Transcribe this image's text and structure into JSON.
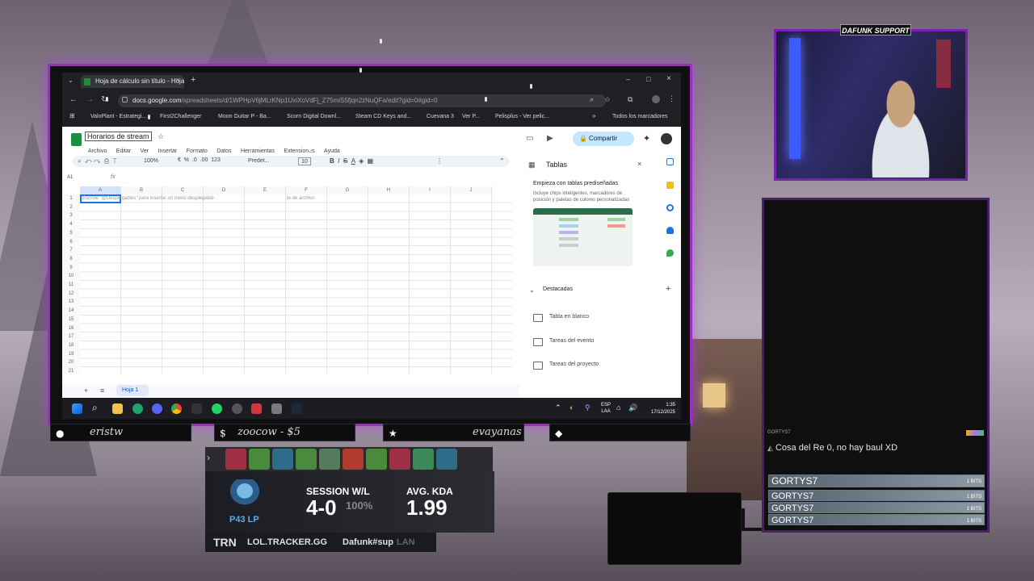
{
  "browser": {
    "tab_title": "Hoja de cálculo sin título - Hoja",
    "url_prefix": "docs.google.com",
    "url_rest": "/spreadsheets/d/1WPHpV6jMLrKNp1UxiXoVdFj_Z75miS5fjqn2zNuQFa/edit?gid=0#gid=0",
    "bookmarks": [
      "ValoPlant - Estrategi...",
      "First2Challenger",
      "Moon Guitar P - Ba...",
      "Scorn Digital Downl...",
      "Steam CD Keys and...",
      "Cuevana 3",
      "Ver P...",
      "Pelisplus - Ver pelic..."
    ],
    "all_bookmarks": "Todos los marcadores"
  },
  "sheets": {
    "doc_title": "Horarios de stream",
    "menu": [
      "Archivo",
      "Editar",
      "Ver",
      "Insertar",
      "Formato",
      "Datos",
      "Herramientas",
      "Extensiones",
      "Ayuda"
    ],
    "zoom": "100%",
    "font": "Predet...",
    "font_size": "10",
    "cell_ref": "A1",
    "share_label": "Compartir",
    "columns": [
      "A",
      "B",
      "C",
      "D",
      "E",
      "F",
      "G",
      "H",
      "I",
      "J"
    ],
    "rows": [
      "1",
      "2",
      "3",
      "4",
      "5",
      "6",
      "7",
      "8",
      "9",
      "10",
      "11",
      "12",
      "13",
      "14",
      "15",
      "16",
      "17",
      "18",
      "19",
      "20",
      "21"
    ],
    "hint_text": "Escribe \"@Desplegables\" para insertar un menú desplegable",
    "hint_text_2": "te de archivo",
    "sheet_tab": "Hoja 1"
  },
  "side_panel": {
    "title": "Tablas",
    "heading": "Empieza con tablas prediseñadas",
    "description": "Incluye chips inteligentes, marcadores de posición y paletas de colores personalizadas",
    "section": "Destacadas",
    "items": [
      "Tabla en blanco",
      "Tareas del evento",
      "Tareas del proyecto"
    ]
  },
  "taskbar": {
    "lang": "ESP",
    "lang2": "LAA",
    "time": "1:35",
    "date": "17/12/2025"
  },
  "webcam": {
    "label": "DAFUNK SUPPORT"
  },
  "chat": {
    "user": "GORTYS7",
    "message": "Cosa del Re 0, no hay baul XD",
    "bits": [
      {
        "name": "GORTYS7",
        "amount": "1 BITS"
      },
      {
        "name": "GORTYS7",
        "amount": "1 BITS"
      },
      {
        "name": "GORTYS7",
        "amount": "1 BITS"
      },
      {
        "name": "GORTYS7",
        "amount": "1 BITS"
      }
    ]
  },
  "overlay": {
    "follower": "eristw",
    "donation": "zoocow - $5",
    "sub": "evayanas",
    "session_label": "SESSION W/L",
    "session_value": "4-0",
    "session_pct": "100%",
    "kda_label": "AVG. KDA",
    "kda_value": "1.99",
    "lp": "P43 LP",
    "trn": "TRN",
    "tracker": "LOL.TRACKER.GG",
    "riot_id": "Dafunk#sup",
    "region": "LAN"
  },
  "colors": {
    "frame": "#9b2fc4",
    "sheets_green": "#1e8e3e",
    "share_bg": "#c2e7ff"
  }
}
